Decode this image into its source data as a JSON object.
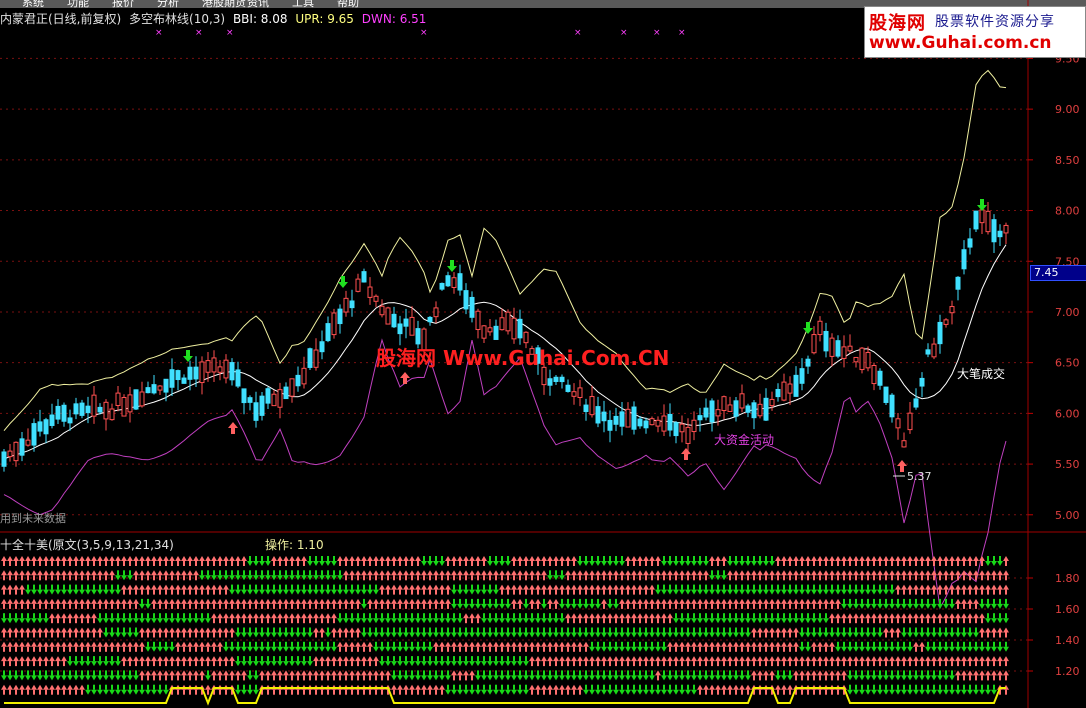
{
  "menu": [
    "系统",
    "功能",
    "报价",
    "分析",
    "港股期货",
    "资讯",
    "工具",
    "帮助"
  ],
  "header": {
    "stock": "内蒙君正(日线,前复权)",
    "indicator": "多空布林线(10,3)",
    "bbi": "BBI: 8.08",
    "upr": "UPR: 9.65",
    "dwn": "DWN: 6.51"
  },
  "logo": {
    "line1": "股海网",
    "line2": "股票软件资源分享",
    "line3": "www.Guhai.com.cn"
  },
  "watermark": "股海网 Www.Guhai.Com.CN",
  "annotations": {
    "big_deal": "大笔成交",
    "big_money": "大资金活动",
    "low_price": "5.37"
  },
  "future_note": "用到未来数据",
  "price_axis": [
    "9.50",
    "9.00",
    "8.50",
    "8.00",
    "7.50",
    "7.00",
    "6.50",
    "6.00",
    "5.50",
    "5.00"
  ],
  "current_price": "7.45",
  "indicator_panel": {
    "title": "十全十美(原文(3,5,9,13,21,34)",
    "operation": "操作: 1.10",
    "axis": [
      "1.80",
      "1.60",
      "1.40",
      "1.20"
    ]
  },
  "colors": {
    "up": "#ff5050",
    "down": "#40e0ff",
    "upper_band": "#f0f0a0",
    "mid_band": "#ffffff",
    "lower_band": "#c040c0",
    "buy_arrow": "#ff6060",
    "sell_arrow": "#20e020",
    "grid": "#7a1010",
    "line_yellow": "#f0f000"
  }
}
